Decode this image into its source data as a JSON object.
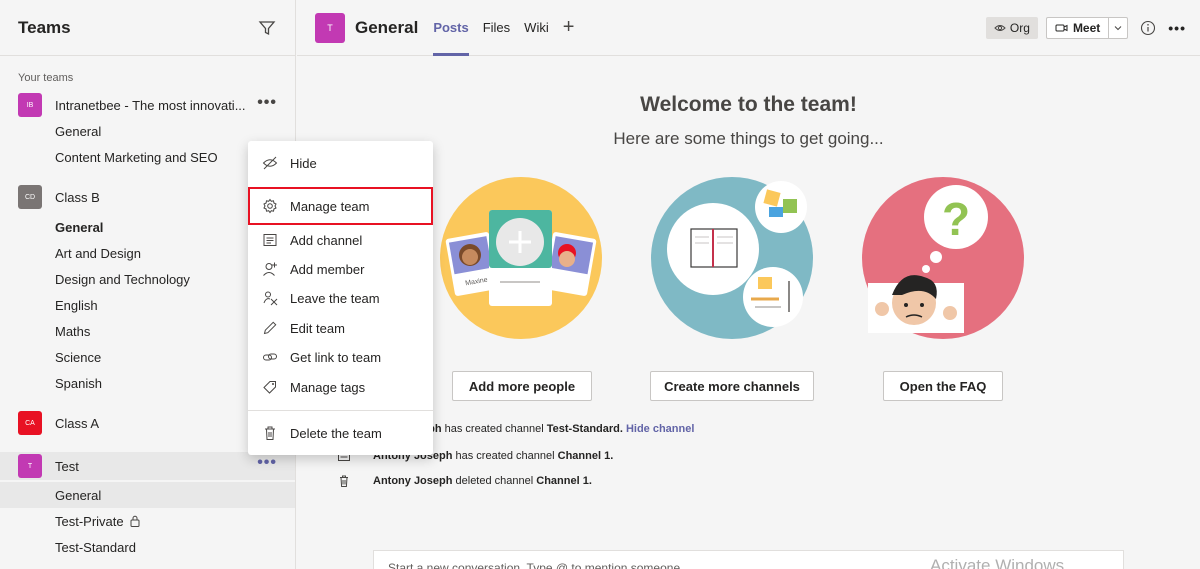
{
  "sidebar": {
    "title": "Teams",
    "your_teams_label": "Your teams",
    "teams": [
      {
        "initials": "IB",
        "name": "Intranetbee - The most innovati...",
        "color": "#c239b3",
        "channels": [
          "General",
          "Content Marketing and SEO"
        ]
      },
      {
        "initials": "CD",
        "name": "Class B",
        "color": "#7a7574",
        "channels": [
          "General",
          "Art and Design",
          "Design and Technology",
          "English",
          "Maths",
          "Science",
          "Spanish"
        ]
      },
      {
        "initials": "CA",
        "name": "Class A",
        "color": "#e81123",
        "channels": []
      },
      {
        "initials": "T",
        "name": "Test",
        "color": "#c239b3",
        "channels": [
          "General",
          "Test-Private",
          "Test-Standard"
        ]
      }
    ]
  },
  "topbar": {
    "avatar": "T",
    "channel_title": "General",
    "tabs": [
      "Posts",
      "Files",
      "Wiki"
    ],
    "org_label": "Org",
    "meet_label": "Meet"
  },
  "main": {
    "welcome": "Welcome to the team!",
    "subtitle": "Here are some things to get going...",
    "buttons": [
      "Add more people",
      "Create more channels",
      "Open the FAQ"
    ],
    "illus_label": "Maxine",
    "activity": [
      {
        "prefix": "eph",
        "text": " has created channel ",
        "channel": "Test-Standard.",
        "link": "Hide channel"
      },
      {
        "user": "Antony Joseph",
        "text": " has created channel ",
        "channel": "Channel 1."
      },
      {
        "user": "Antony Joseph",
        "text": " deleted channel ",
        "channel": "Channel 1."
      }
    ],
    "compose_placeholder": "Start a new conversation. Type @ to mention someone.",
    "watermark": "Activate Windows"
  },
  "context_menu": {
    "items": [
      {
        "label": "Hide",
        "icon": "hide-icon"
      },
      {
        "label": "Manage team",
        "icon": "gear-icon"
      },
      {
        "label": "Add channel",
        "icon": "channel-icon"
      },
      {
        "label": "Add member",
        "icon": "add-member-icon"
      },
      {
        "label": "Leave the team",
        "icon": "leave-icon"
      },
      {
        "label": "Edit team",
        "icon": "pencil-icon"
      },
      {
        "label": "Get link to team",
        "icon": "link-icon"
      },
      {
        "label": "Manage tags",
        "icon": "tag-icon"
      },
      {
        "label": "Delete the team",
        "icon": "trash-icon"
      }
    ]
  },
  "colors": {
    "accent": "#6264a7",
    "highlight_border": "#e81123"
  }
}
